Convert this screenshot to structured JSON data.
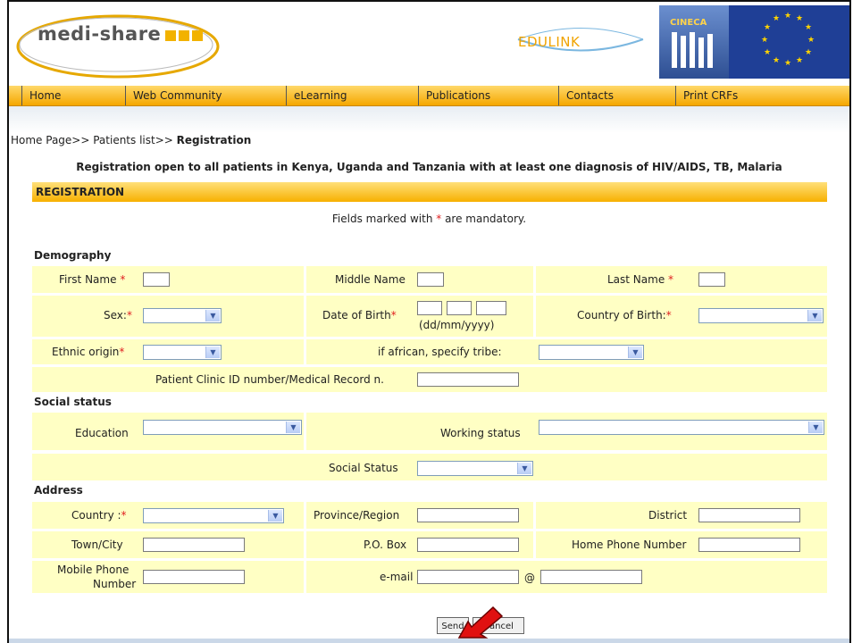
{
  "header": {
    "logo_text": "medi-share",
    "partner1": "EDULINK",
    "partner2": "CINECA"
  },
  "nav": {
    "items": [
      "Home",
      "Web Community",
      "eLearning",
      "Publications",
      "Contacts",
      "Print CRFs"
    ]
  },
  "breadcrumb": {
    "path": "Home Page>> Patients list>> ",
    "current": "Registration"
  },
  "notice": "Registration open to all patients in Kenya, Uganda and Tanzania with at least one diagnosis of HIV/AIDS, TB, Malaria",
  "section_header": "REGISTRATION",
  "mandatory": {
    "before": "Fields marked with ",
    "star": "*",
    "after": " are mandatory."
  },
  "demography": {
    "title": "Demography",
    "first_name": "First Name",
    "middle_name": "Middle Name",
    "last_name": "Last Name",
    "sex": "Sex:",
    "dob": "Date of Birth",
    "dob_format": "(dd/mm/yyyy)",
    "country_of_birth": "Country of Birth:",
    "ethnic_origin": "Ethnic origin",
    "tribe": "if african, specify tribe:",
    "clinic_id": "Patient Clinic ID number/Medical Record n."
  },
  "social": {
    "title": "Social status",
    "education": "Education",
    "working_status": "Working status",
    "social_status": "Social Status"
  },
  "address": {
    "title": "Address",
    "country": "Country :",
    "province": "Province/Region",
    "district": "District",
    "town": "Town/City",
    "po_box": "P.O. Box",
    "home_phone": "Home Phone Number",
    "mobile_line1": "Mobile Phone",
    "mobile_line2": "Number",
    "email": "e-mail",
    "at": "@"
  },
  "buttons": {
    "send": "Send",
    "cancel": "Cancel"
  },
  "colors": {
    "nav_bar": "#f5a700",
    "form_row": "#ffffc4",
    "mandatory_star": "#e02020",
    "annotation_arrow": "#e01010"
  }
}
